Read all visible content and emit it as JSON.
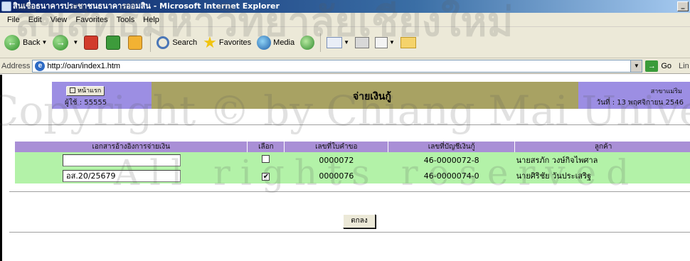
{
  "window": {
    "title": "สินเชื่อธนาคารประชาชนธนาคารออมสิน - Microsoft Internet Explorer",
    "min_glyph": "_"
  },
  "menu": [
    "File",
    "Edit",
    "View",
    "Favorites",
    "Tools",
    "Help"
  ],
  "toolbar": {
    "back_label": "Back",
    "search_label": "Search",
    "favorites_label": "Favorites",
    "media_label": "Media"
  },
  "address": {
    "label": "Address",
    "url": "http://oan/index1.htm",
    "go_label": "Go",
    "links_label": "Lin"
  },
  "page": {
    "home_button": "หน้าแรก",
    "user": "ผู้ใช้ : 55555",
    "title": "จ่ายเงินกู้",
    "branch": "สาขาแม่ริม",
    "date": "วันที่ : 13 พฤศจิกายน 2546",
    "table": {
      "headers": [
        "เอกสารอ้างอิงการจ่ายเงิน",
        "เลือก",
        "เลขที่ใบคำขอ",
        "เลขที่บัญชีเงินกู้",
        "ลูกค้า"
      ],
      "rows": [
        {
          "ref": "",
          "selected": false,
          "request_no": "0000072",
          "account_no": "46-0000072-8",
          "customer": "นายสรภัก วงษ์กิจไพศาล"
        },
        {
          "ref": "อส.20/25679",
          "selected": true,
          "request_no": "0000076",
          "account_no": "46-0000074-0",
          "customer": "นายศิริชัย วันประเสริฐ"
        }
      ]
    },
    "ok_button": "ตกลง"
  },
  "watermark": {
    "line1": "ลิขสิทธิ์มหาวิทยาลัยเชียงใหม่",
    "line2": "Copyright © by Chiang Mai University",
    "line3": "All rights reserved"
  }
}
